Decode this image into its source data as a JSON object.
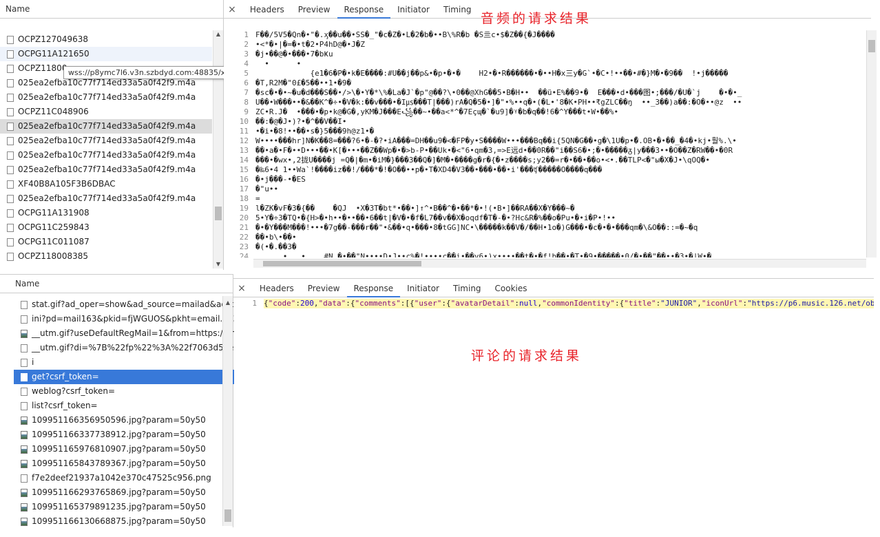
{
  "top_panel": {
    "name_header": "Name",
    "requests": [
      {
        "label": "OCPZ127049638",
        "state": ""
      },
      {
        "label": "OCPG11A121650",
        "state": "hover"
      },
      {
        "label": "OCPZ11800",
        "state": ""
      },
      {
        "label": "025ea2efba10c77f714ed33a5a0f42f9.m4a",
        "state": ""
      },
      {
        "label": "025ea2efba10c77f714ed33a5a0f42f9.m4a",
        "state": ""
      },
      {
        "label": "OCPZ11C048906",
        "state": ""
      },
      {
        "label": "025ea2efba10c77f714ed33a5a0f42f9.m4a",
        "state": "sel-grey"
      },
      {
        "label": "025ea2efba10c77f714ed33a5a0f42f9.m4a",
        "state": ""
      },
      {
        "label": "025ea2efba10c77f714ed33a5a0f42f9.m4a",
        "state": ""
      },
      {
        "label": "025ea2efba10c77f714ed33a5a0f42f9.m4a",
        "state": ""
      },
      {
        "label": "XF40B8A105F3B6DBAC",
        "state": ""
      },
      {
        "label": "025ea2efba10c77f714ed33a5a0f42f9.m4a",
        "state": ""
      },
      {
        "label": "OCPG11A131908",
        "state": ""
      },
      {
        "label": "OCPG11C259843",
        "state": ""
      },
      {
        "label": "OCPG11C011087",
        "state": ""
      },
      {
        "label": "OCPZ118008385",
        "state": ""
      }
    ],
    "tooltip": "wss://p8ymc7l6.v3n.szbdyd.com:48835/xyvod/p2sp/OCPG11A121650",
    "close_symbol": "×",
    "tabs": [
      "Headers",
      "Preview",
      "Response",
      "Initiator",
      "Timing"
    ],
    "active_tab": "Response",
    "annotation": "音频的请求结果",
    "line_numbers": [
      "1",
      "2",
      "3",
      "4",
      "5",
      "6",
      "7",
      "8",
      "9",
      "10",
      "11",
      "12",
      "13",
      "14",
      "15",
      "16",
      "17",
      "18",
      "19",
      "20",
      "21",
      "22",
      "23",
      "24"
    ],
    "code_lines": [
      "F��/5V5�Qn�•\"�.ӽ��u��•SS�_\"�c�Z�•L�2�b�••B\\%R�b �S亖c•$�Z��{�J����",
      "•<*�•|�=�•t�2•P4hD@�•J�Z",
      "�j•��@�•���•7�bҜu",
      "  •      •",
      "            {e1�6�P�•k�E����:#U��j��p&•�p•�•�    H2•�•R������•�••H�x三y�G`•�C•!••��•#�}M�•�9��  !•j�����",
      "�T,R2M�\"0£�5��••1•�9�",
      "�sc�•�•~�u�d���S��•/>\\�•Y�*\\%�La�J`�p\"@��?\\•0��@XhG��5•B�H••  ��ü•E%��9•�  E���•d•���图•;���/�U�`j    �•�•_",
      "U��•W���••�&��K^�÷•�V�k:��v���•�I㎲���T|���)rA�Q�5�•]�\"•%••q�•(�L•'8�K•PH••₹gZLC��ŋ  ••_3��)a��:�O�••@z  ••",
      "ZC•R.J�  •���•�p•k@�G�,yKM�J���E꧁��~•��a<*^�7Eçɰ�`�u9]�ᵞ�b�q��!6�^Y���t•W•��%•",
      "��:�@�J•)?•�^��V��I•",
      "•�i•�8!••��•s�}5���9h@z1•�",
      "W••••���hr]N�K��8=���?6•�-�?•iA���=DH��u9�<�FP�y•S����W•••���Bq��i{5QN�G��•g�\\1U�p•�ّ.OB•�•��_�4�•kj•훨%.\\•",
      "��•a�•F�••D•••��•K[�•••��Z��Wp�•�>b-P•��Uk•�<\"6•qm�3,=>E远d•��0R��\"i��S6�•;�•�����ᵹ|y���3••�O��Z�RW��•�0R",
      "���•�wx•,2拢U����j =Q�|�m•�iM�}���3��Q�]�M�•����g�r�{�•z����s;y2��=r�•��•��o•<•.��TLP<�\"ы�X�J•\\qOQ�•",
      "�‰6•4 1••Wa`!����iz��!/���*�!�O��••p�•T�XD4�V3��•���•��•i'���ʧ�����O����q���",
      "�•j���-•�ES",
      "�\"u••",
      "=",
      "l�ZK�vF�3�{��    �QJ  •X�3T�bt*•��•]↑^•B��^�•��*�•!(•B•]��RA��X�Y���~�",
      "5•Y�÷3�TQ•�{H>�•h••�••��•6��t|�V�•�f�L7��v��X�oqdf�T�-�•?Hc&R�%��o�Pu•�•i�P•!••",
      "�•�Y���M���!•••�7g��-���r��\"•&��•q•���•8�tGG]NC•\\�����k��V�/��H•1o�)G���•�c�•�•���qm�\\&O��::=�~�q",
      "��•b\\•��•",
      "�(•�.��3�",
      "      •   •    #N.�•��\"N••••D•J••c%�!••••c��i•��v6•)x••••��t�•�f!b��•�T•�9•�����•0/�•��\"��••�3•�|W•�"
    ]
  },
  "bottom_panel": {
    "name_header": "Name",
    "requests": [
      {
        "label": "stat.gif?ad_oper=show&ad_source=mailad&ad_posit",
        "icon": "file",
        "state": ""
      },
      {
        "label": "ini?pd=mail163&pkid=fjWGUOS&pkht=email.163.cc",
        "icon": "file",
        "state": ""
      },
      {
        "label": "__utm.gif?useDefaultRegMail=1&from=https://email",
        "icon": "image",
        "state": ""
      },
      {
        "label": "__utm.gif?di=%7B%22fp%22%3A%22f7063d5aeeb07",
        "icon": "file",
        "state": ""
      },
      {
        "label": "i",
        "icon": "file",
        "state": ""
      },
      {
        "label": "get?csrf_token=",
        "icon": "file",
        "state": "sel-blue"
      },
      {
        "label": "weblog?csrf_token=",
        "icon": "file",
        "state": ""
      },
      {
        "label": "list?csrf_token=",
        "icon": "file",
        "state": ""
      },
      {
        "label": "109951166356950596.jpg?param=50y50",
        "icon": "image",
        "state": ""
      },
      {
        "label": "109951166337738912.jpg?param=50y50",
        "icon": "image",
        "state": ""
      },
      {
        "label": "109951165976810907.jpg?param=50y50",
        "icon": "image",
        "state": ""
      },
      {
        "label": "109951165843789367.jpg?param=50y50",
        "icon": "image",
        "state": ""
      },
      {
        "label": "f7e2deef21937a1042e370c47525c956.png",
        "icon": "file",
        "state": ""
      },
      {
        "label": "109951166293765869.jpg?param=50y50",
        "icon": "image",
        "state": ""
      },
      {
        "label": "109951165379891235.jpg?param=50y50",
        "icon": "image",
        "state": ""
      },
      {
        "label": "109951166130668875.jpg?param=50y50",
        "icon": "image",
        "state": ""
      }
    ],
    "close_symbol": "×",
    "tabs": [
      "Headers",
      "Preview",
      "Response",
      "Initiator",
      "Timing",
      "Cookies"
    ],
    "active_tab": "Response",
    "annotation": "评论的请求结果",
    "line_number": "1",
    "json_tokens": [
      {
        "t": "p",
        "v": "{"
      },
      {
        "t": "k",
        "v": "\"code\""
      },
      {
        "t": "p",
        "v": ":"
      },
      {
        "t": "n",
        "v": "200"
      },
      {
        "t": "p",
        "v": ","
      },
      {
        "t": "k",
        "v": "\"data\""
      },
      {
        "t": "p",
        "v": ":{"
      },
      {
        "t": "k",
        "v": "\"comments\""
      },
      {
        "t": "p",
        "v": ":[{"
      },
      {
        "t": "k",
        "v": "\"user\""
      },
      {
        "t": "p",
        "v": ":{"
      },
      {
        "t": "k",
        "v": "\"avatarDetail\""
      },
      {
        "t": "p",
        "v": ":"
      },
      {
        "t": "n",
        "v": "null"
      },
      {
        "t": "p",
        "v": ","
      },
      {
        "t": "k",
        "v": "\"commonIdentity\""
      },
      {
        "t": "p",
        "v": ":{"
      },
      {
        "t": "k",
        "v": "\"title\""
      },
      {
        "t": "p",
        "v": ":"
      },
      {
        "t": "s",
        "v": "\"JUNIOR\""
      },
      {
        "t": "p",
        "v": ","
      },
      {
        "t": "k",
        "v": "\"iconUrl\""
      },
      {
        "t": "p",
        "v": ":"
      },
      {
        "t": "s",
        "v": "\"https://p6.music.126.net/ob"
      }
    ]
  },
  "colors": {
    "annotation": "#e8232a",
    "selected_blue": "#3879d9",
    "tab_underline": "#3879d9",
    "json_highlight": "#fff7b3"
  }
}
